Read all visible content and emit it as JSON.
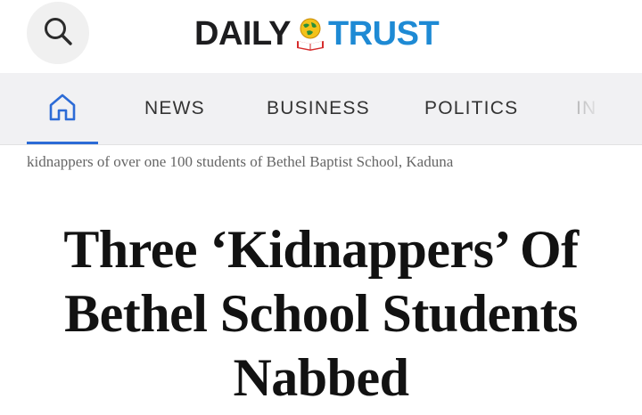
{
  "header": {
    "search_icon": "search-icon",
    "logo": {
      "word1": "DAILY",
      "word2": "TRUST",
      "colors": {
        "word1": "#1d1d1f",
        "word2": "#1e8ad4"
      }
    }
  },
  "nav": {
    "home_icon": "home-icon",
    "active": "home",
    "items": [
      {
        "label": "NEWS"
      },
      {
        "label": "BUSINESS"
      },
      {
        "label": "POLITICS"
      },
      {
        "label": "IN"
      }
    ],
    "accent": "#2c6bd6"
  },
  "article": {
    "tagline": "kidnappers of over one 100 students of Bethel Baptist School, Kaduna",
    "headline": "Three ‘Kidnappers’ Of Bethel School Students Nabbed"
  }
}
